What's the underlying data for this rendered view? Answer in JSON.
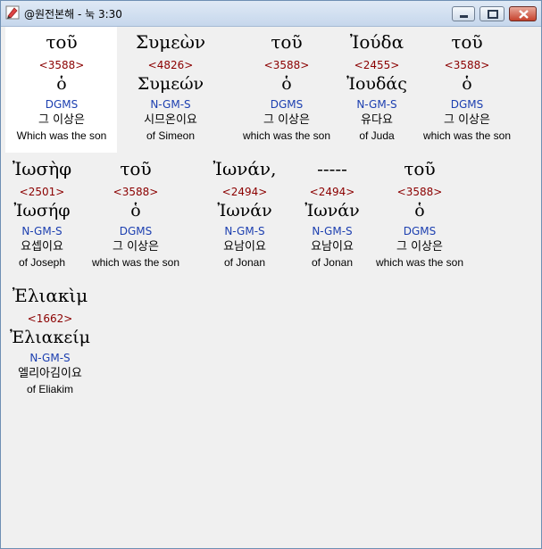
{
  "window": {
    "title": "@원전본해 - 눅 3:30"
  },
  "words": [
    {
      "greek": "τοῦ",
      "strong": "<3588>",
      "lemma": "ὁ",
      "morph": "DGMS",
      "korean": "그 이상은",
      "english": "Which was the son"
    },
    {
      "greek": "Συμεὼν",
      "strong": "<4826>",
      "lemma": "Συμεών",
      "morph": "N-GM-S",
      "korean": "시므온이요",
      "english": "of Simeon"
    },
    {
      "greek": "τοῦ",
      "strong": "<3588>",
      "lemma": "ὁ",
      "morph": "DGMS",
      "korean": "그 이상은",
      "english": "which was the son"
    },
    {
      "greek": "Ἰούδα",
      "strong": "<2455>",
      "lemma": "Ἰουδάς",
      "morph": "N-GM-S",
      "korean": "유다요",
      "english": "of Juda"
    },
    {
      "greek": "τοῦ",
      "strong": "<3588>",
      "lemma": "ὁ",
      "morph": "DGMS",
      "korean": "그 이상은",
      "english": "which was the son"
    },
    {
      "greek": "Ἰωσὴφ",
      "strong": "<2501>",
      "lemma": "Ἰωσήφ",
      "morph": "N-GM-S",
      "korean": "요셉이요",
      "english": "of Joseph"
    },
    {
      "greek": "τοῦ",
      "strong": "<3588>",
      "lemma": "ὁ",
      "morph": "DGMS",
      "korean": "그 이상은",
      "english": "which was the son"
    },
    {
      "greek": "Ἰωνάν,",
      "strong": "<2494>",
      "lemma": "Ἰωνάν",
      "morph": "N-GM-S",
      "korean": "요남이요",
      "english": "of Jonan"
    },
    {
      "greek": "-----",
      "strong": "<2494>",
      "lemma": "Ἰωνάν",
      "morph": "N-GM-S",
      "korean": "요남이요",
      "english": "of Jonan"
    },
    {
      "greek": "τοῦ",
      "strong": "<3588>",
      "lemma": "ὁ",
      "morph": "DGMS",
      "korean": "그 이상은",
      "english": "which was the son"
    },
    {
      "greek": "Ἐλιακὶμ",
      "strong": "<1662>",
      "lemma": "Ἐλιακείμ",
      "morph": "N-GM-S",
      "korean": "엘리아김이요",
      "english": "of Eliakim"
    }
  ],
  "colors": {
    "strong_number": "#8b0000",
    "morphology": "#1c3fb0",
    "selected_background": "#ffffff"
  },
  "icons": {
    "app": "app-icon",
    "minimize": "minimize-icon",
    "maximize": "maximize-icon",
    "close": "close-icon"
  }
}
